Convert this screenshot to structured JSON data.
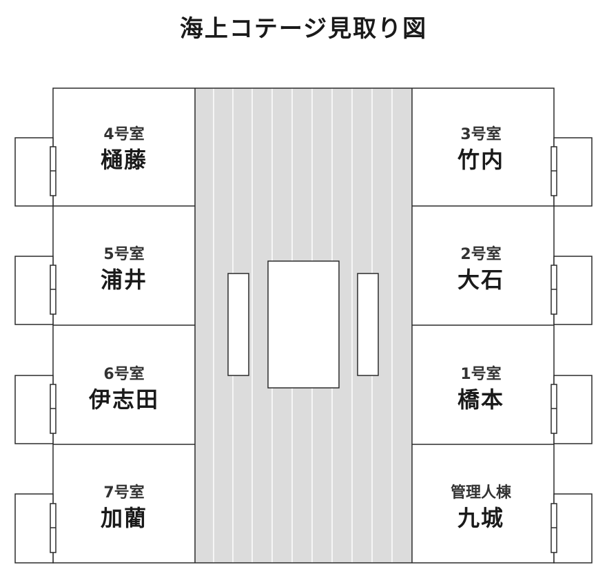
{
  "title": "海上コテージ見取り図",
  "rooms": {
    "room4": {
      "number": "4号室",
      "name": "樋藤"
    },
    "room5": {
      "number": "5号室",
      "name": "浦井"
    },
    "room6": {
      "number": "6号室",
      "name": "伊志田"
    },
    "room7": {
      "number": "7号室",
      "name": "加藺"
    },
    "room3": {
      "number": "3号室",
      "name": "竹内"
    },
    "room2": {
      "number": "2号室",
      "name": "大石"
    },
    "room1": {
      "number": "1号室",
      "name": "橋本"
    },
    "admin": {
      "number": "管理人棟",
      "name": "九城"
    }
  },
  "colors": {
    "line": "#2a2a2a",
    "corridor": "#dcdcdc",
    "plank": "#ffffff",
    "background": "#ffffff"
  }
}
